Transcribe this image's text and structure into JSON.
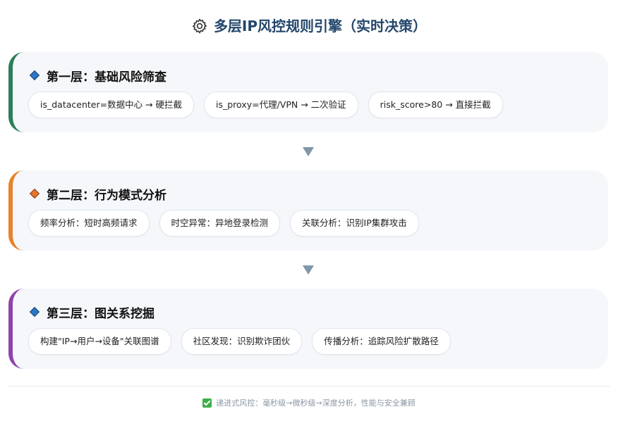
{
  "title": {
    "text": "多层IP风控规则引擎（实时决策）",
    "icon": "gear-icon"
  },
  "layers": [
    {
      "heading": "第一层：基础风险筛查",
      "icon": "diamond-blue-icon",
      "accent_color": "#2e7d5b",
      "items": [
        "is_datacenter=数据中心 → 硬拦截",
        "is_proxy=代理/VPN → 二次验证",
        "risk_score>80 → 直接拦截"
      ]
    },
    {
      "heading": "第二层：行为模式分析",
      "icon": "diamond-orange-icon",
      "accent_color": "#e8822c",
      "items": [
        "频率分析：短时高频请求",
        "时空异常：异地登录检测",
        "关联分析：识别IP集群攻击"
      ]
    },
    {
      "heading": "第三层：图关系挖掘",
      "icon": "diamond-blue-icon",
      "accent_color": "#8e44ad",
      "items": [
        "构建\"IP→用户→设备\"关联图谱",
        "社区发现：识别欺诈团伙",
        "传播分析：追踪风险扩散路径"
      ]
    }
  ],
  "footer": {
    "icon": "checkmark-icon",
    "text": "递进式风控：毫秒级→微秒级→深度分析，性能与安全兼顾"
  }
}
